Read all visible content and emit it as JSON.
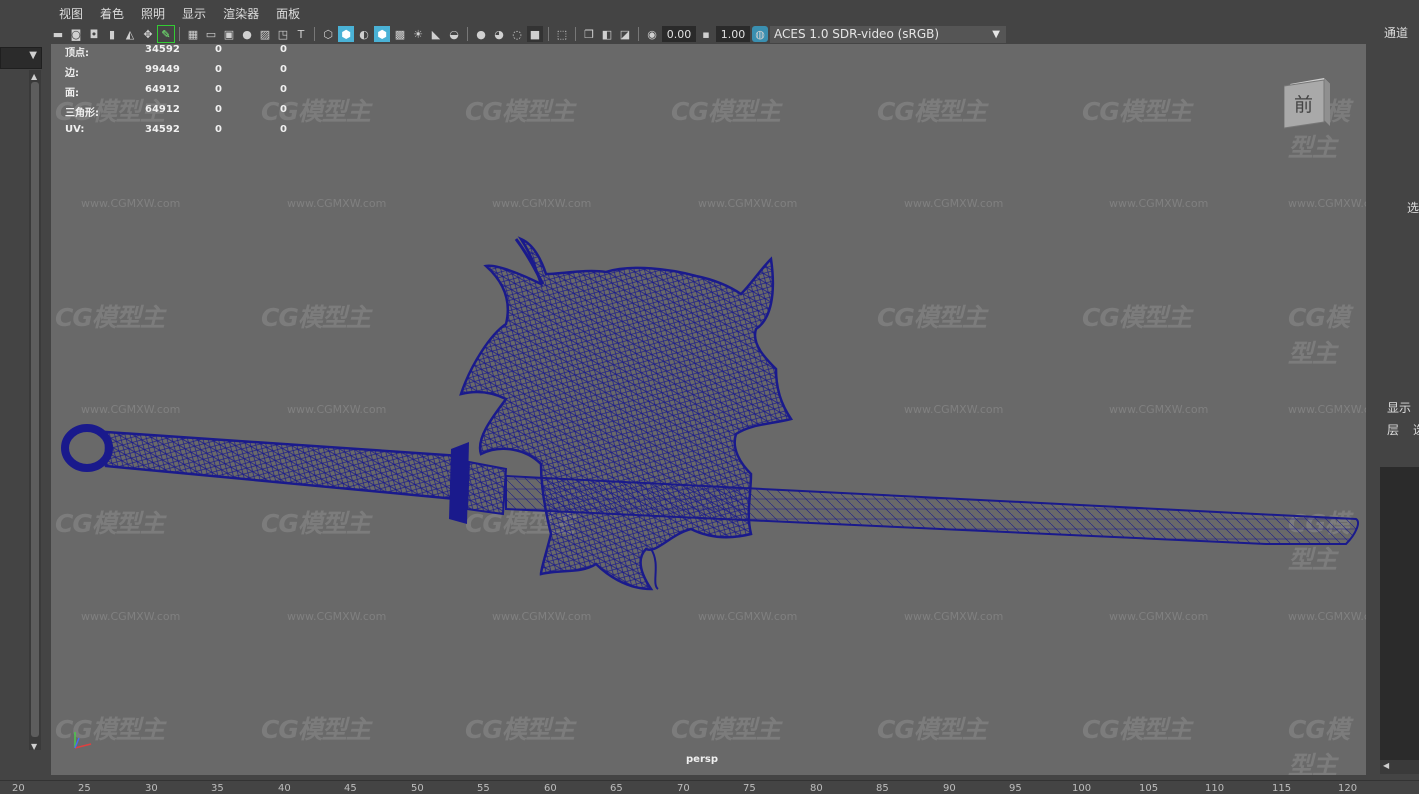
{
  "menubar": [
    "视图",
    "着色",
    "照明",
    "显示",
    "渲染器",
    "面板"
  ],
  "toolbar": {
    "icons": [
      "camera-icon",
      "camera-attr-icon",
      "bookmark-icon",
      "image-plane-icon",
      "grid-icon",
      "film-gate-icon",
      "resolution-gate-icon",
      "gate-mask-icon",
      "field-chart-icon",
      "safe-action-icon",
      "safe-title-icon",
      "wireframe-icon",
      "smooth-shade-icon",
      "default-material-icon",
      "xray-icon",
      "textured-icon",
      "lighting-icon",
      "shadows-icon",
      "ambient-occlusion-icon",
      "motion-blur-icon",
      "antialias-icon",
      "isolate-icon",
      "xray-joints-icon",
      "xray-active-icon",
      "backface-icon",
      "exposure-icon",
      "gamma-icon"
    ],
    "exposure_value": "0.00",
    "gamma_value": "1.00",
    "colorspace_label": "ACES 1.0 SDR-video (sRGB)"
  },
  "hud": [
    {
      "label": "顶点:",
      "v1": "34592",
      "v2": "0",
      "v3": "0"
    },
    {
      "label": "边:",
      "v1": "99449",
      "v2": "0",
      "v3": "0"
    },
    {
      "label": "面:",
      "v1": "64912",
      "v2": "0",
      "v3": "0"
    },
    {
      "label": "三角形:",
      "v1": "64912",
      "v2": "0",
      "v3": "0"
    },
    {
      "label": "UV:",
      "v1": "34592",
      "v2": "0",
      "v3": "0"
    }
  ],
  "viewcube_label": "前",
  "camera_label": "persp",
  "watermark_logo": "CG模型主",
  "watermark_url": "www.CGMXW.com",
  "right_panel": {
    "channel_label": "通道",
    "select_label": "选",
    "display_label": "显示",
    "layer_label": "层",
    "layer_label2": "选"
  },
  "ruler_ticks": [
    "20",
    "25",
    "30",
    "35",
    "40",
    "45",
    "50",
    "55",
    "60",
    "65",
    "70",
    "75",
    "80",
    "85",
    "90",
    "95",
    "100",
    "105",
    "110",
    "115",
    "120"
  ],
  "colors": {
    "wireframe": "#1a1a8c",
    "viewport_bg": "#696969",
    "panel_bg": "#444444",
    "highlight": "#4ab2d6"
  }
}
